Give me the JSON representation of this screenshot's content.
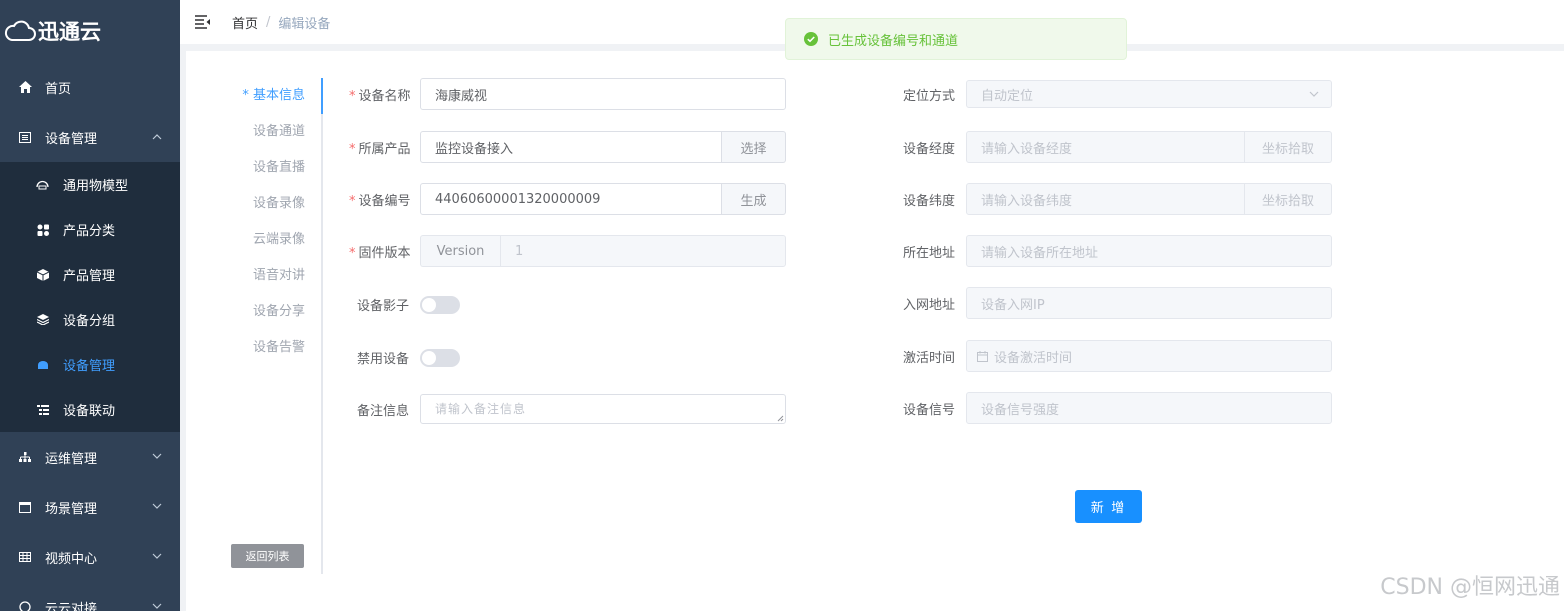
{
  "app": {
    "logo_text": "迅通云"
  },
  "sidebar": {
    "items": [
      {
        "label": "首页",
        "icon": "home-icon"
      },
      {
        "label": "设备管理",
        "icon": "device-icon",
        "expanded": true,
        "children": [
          {
            "label": "通用物模型",
            "icon": "model-icon"
          },
          {
            "label": "产品分类",
            "icon": "category-icon"
          },
          {
            "label": "产品管理",
            "icon": "cube-icon"
          },
          {
            "label": "设备分组",
            "icon": "layers-icon"
          },
          {
            "label": "设备管理",
            "icon": "device-manage-icon",
            "active": true
          },
          {
            "label": "设备联动",
            "icon": "linkage-icon"
          }
        ]
      },
      {
        "label": "运维管理",
        "icon": "sitemap-icon"
      },
      {
        "label": "场景管理",
        "icon": "scene-icon"
      },
      {
        "label": "视频中心",
        "icon": "video-icon"
      },
      {
        "label": "云云对接",
        "icon": "cloud-link-icon"
      }
    ]
  },
  "header": {
    "breadcrumb": {
      "home": "首页",
      "separator": "/",
      "current": "编辑设备"
    }
  },
  "toast": {
    "message": "已生成设备编号和通道",
    "type": "success"
  },
  "tabs": {
    "items": [
      "* 基本信息",
      "设备通道",
      "设备直播",
      "设备录像",
      "云端录像",
      "语音对讲",
      "设备分享",
      "设备告警"
    ],
    "active_index": 0,
    "back_label": "返回列表"
  },
  "form": {
    "device_name": {
      "label": "设备名称",
      "required": true,
      "value": "海康威视"
    },
    "product": {
      "label": "所属产品",
      "required": true,
      "value": "监控设备接入",
      "button": "选择"
    },
    "device_sn": {
      "label": "设备编号",
      "required": true,
      "value": "44060600001320000009",
      "button": "生成"
    },
    "firmware": {
      "label": "固件版本",
      "required": true,
      "prepend": "Version",
      "value": "1"
    },
    "shadow": {
      "label": "设备影子",
      "enabled": false
    },
    "disabled": {
      "label": "禁用设备",
      "enabled": false
    },
    "remark": {
      "label": "备注信息",
      "placeholder": "请输入备注信息"
    },
    "locate_mode": {
      "label": "定位方式",
      "value": "自动定位"
    },
    "longitude": {
      "label": "设备经度",
      "placeholder": "请输入设备经度",
      "button": "坐标拾取"
    },
    "latitude": {
      "label": "设备纬度",
      "placeholder": "请输入设备纬度",
      "button": "坐标拾取"
    },
    "address": {
      "label": "所在地址",
      "placeholder": "请输入设备所在地址"
    },
    "network_addr": {
      "label": "入网地址",
      "placeholder": "设备入网IP"
    },
    "activate_time": {
      "label": "激活时间",
      "placeholder": "设备激活时间"
    },
    "signal": {
      "label": "设备信号",
      "placeholder": "设备信号强度"
    },
    "submit_label": "新 增"
  },
  "watermark": "CSDN @恒网迅通"
}
